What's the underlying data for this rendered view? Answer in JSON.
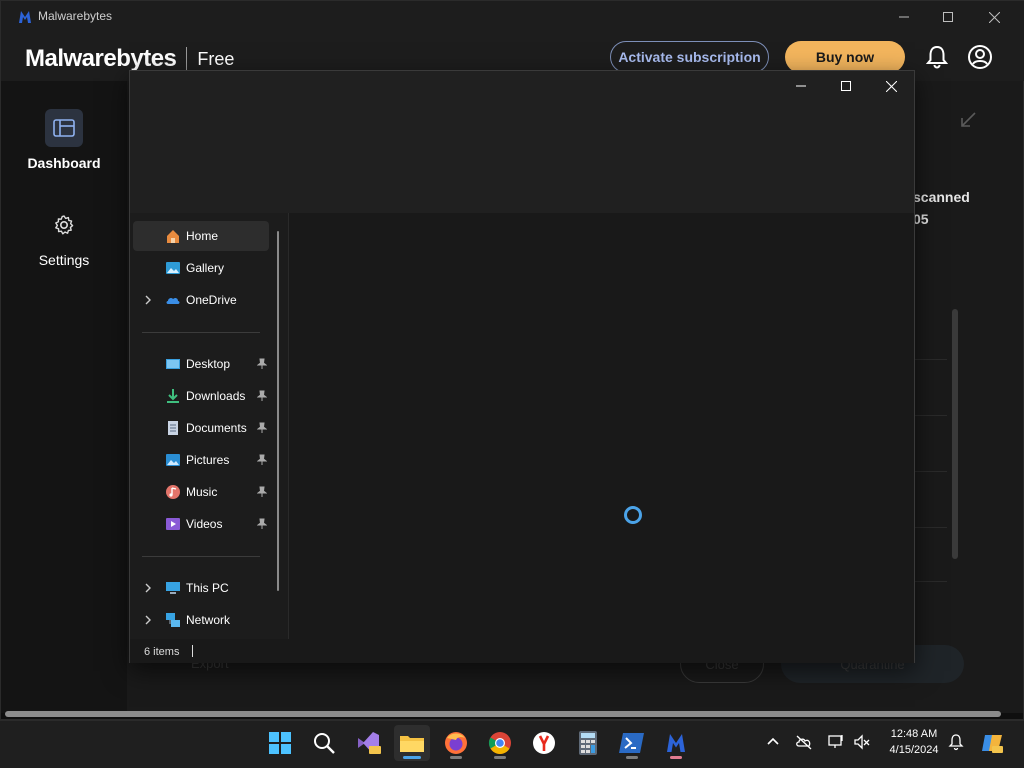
{
  "window": {
    "title": "Malwarebytes"
  },
  "header": {
    "brand": "Malwarebytes",
    "tier": "Free",
    "activate_label": "Activate subscription",
    "buy_label": "Buy now"
  },
  "sidebar": {
    "items": [
      {
        "label": "Dashboard",
        "icon": "dashboard-icon",
        "selected": true
      },
      {
        "label": "Settings",
        "icon": "gear-icon",
        "selected": false
      }
    ]
  },
  "background": {
    "scanned_label": "scanned",
    "scanned_value": "05",
    "close_label": "Close",
    "quarantine_label": "Quarantine",
    "export_label": "Export"
  },
  "explorer": {
    "nav": [
      {
        "label": "Home",
        "icon": "home-icon",
        "selected": true,
        "expandable": false,
        "pinned": false
      },
      {
        "label": "Gallery",
        "icon": "gallery-icon",
        "selected": false,
        "expandable": false,
        "pinned": false
      },
      {
        "label": "OneDrive",
        "icon": "onedrive-icon",
        "selected": false,
        "expandable": true,
        "pinned": false
      },
      {
        "label": "Desktop",
        "icon": "desktop-icon",
        "selected": false,
        "expandable": false,
        "pinned": true
      },
      {
        "label": "Downloads",
        "icon": "download-icon",
        "selected": false,
        "expandable": false,
        "pinned": true
      },
      {
        "label": "Documents",
        "icon": "documents-icon",
        "selected": false,
        "expandable": false,
        "pinned": true
      },
      {
        "label": "Pictures",
        "icon": "pictures-icon",
        "selected": false,
        "expandable": false,
        "pinned": true
      },
      {
        "label": "Music",
        "icon": "music-icon",
        "selected": false,
        "expandable": false,
        "pinned": true
      },
      {
        "label": "Videos",
        "icon": "videos-icon",
        "selected": false,
        "expandable": false,
        "pinned": true
      },
      {
        "label": "This PC",
        "icon": "this-pc-icon",
        "selected": false,
        "expandable": true,
        "pinned": false
      },
      {
        "label": "Network",
        "icon": "network-icon",
        "selected": false,
        "expandable": true,
        "pinned": false
      }
    ],
    "status": "6 items"
  },
  "taskbar": {
    "apps": [
      "start-icon",
      "search-icon",
      "visual-studio-icon",
      "file-explorer-icon",
      "firefox-icon",
      "chrome-icon",
      "yandex-icon",
      "calculator-icon",
      "powershell-icon",
      "malwarebytes-icon"
    ],
    "time": "12:48 AM",
    "date": "4/15/2024"
  },
  "colors": {
    "accent": "#4ba3e8",
    "buy": "#f3b55d",
    "activate": "#a9bcf0"
  }
}
